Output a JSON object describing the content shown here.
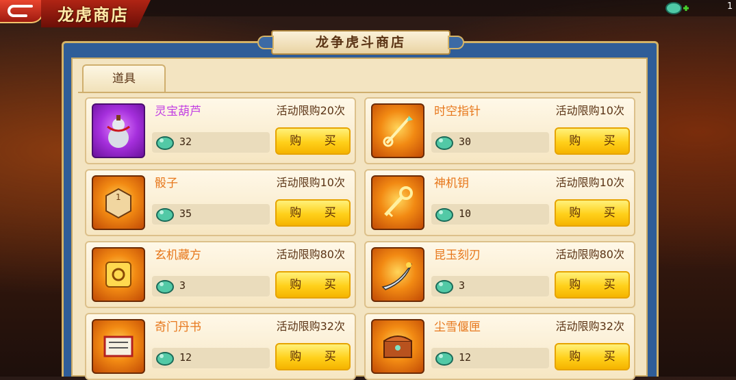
{
  "header": {
    "page_title": "龙虎商店",
    "top_count": "1"
  },
  "shop": {
    "banner_title": "龙争虎斗商店",
    "tabs": [
      {
        "label": "道具"
      }
    ]
  },
  "items": [
    {
      "name": "灵宝葫芦",
      "limit": "活动限购20次",
      "price": "32",
      "buy": "购 买",
      "icon": "gourd-icon"
    },
    {
      "name": "时空指针",
      "limit": "活动限购10次",
      "price": "30",
      "buy": "购 买",
      "icon": "pointer-icon"
    },
    {
      "name": "骰子",
      "limit": "活动限购10次",
      "price": "35",
      "buy": "购 买",
      "icon": "dice-icon"
    },
    {
      "name": "神机钥",
      "limit": "活动限购10次",
      "price": "10",
      "buy": "购 买",
      "icon": "key-icon"
    },
    {
      "name": "玄机藏方",
      "limit": "活动限购80次",
      "price": "3",
      "buy": "购 买",
      "icon": "cube-icon"
    },
    {
      "name": "昆玉刻刃",
      "limit": "活动限购80次",
      "price": "3",
      "buy": "购 买",
      "icon": "blade-icon"
    },
    {
      "name": "奇门丹书",
      "limit": "活动限购32次",
      "price": "12",
      "buy": "购 买",
      "icon": "scroll-icon"
    },
    {
      "name": "尘雪偃匣",
      "limit": "活动限购32次",
      "price": "12",
      "buy": "购 买",
      "icon": "chest-icon"
    }
  ],
  "colors": {
    "rare_name": "#c23fe3",
    "normal_name": "#e7771b",
    "buy_button": "#ffd01a",
    "frame_blue": "#2f5d98"
  }
}
